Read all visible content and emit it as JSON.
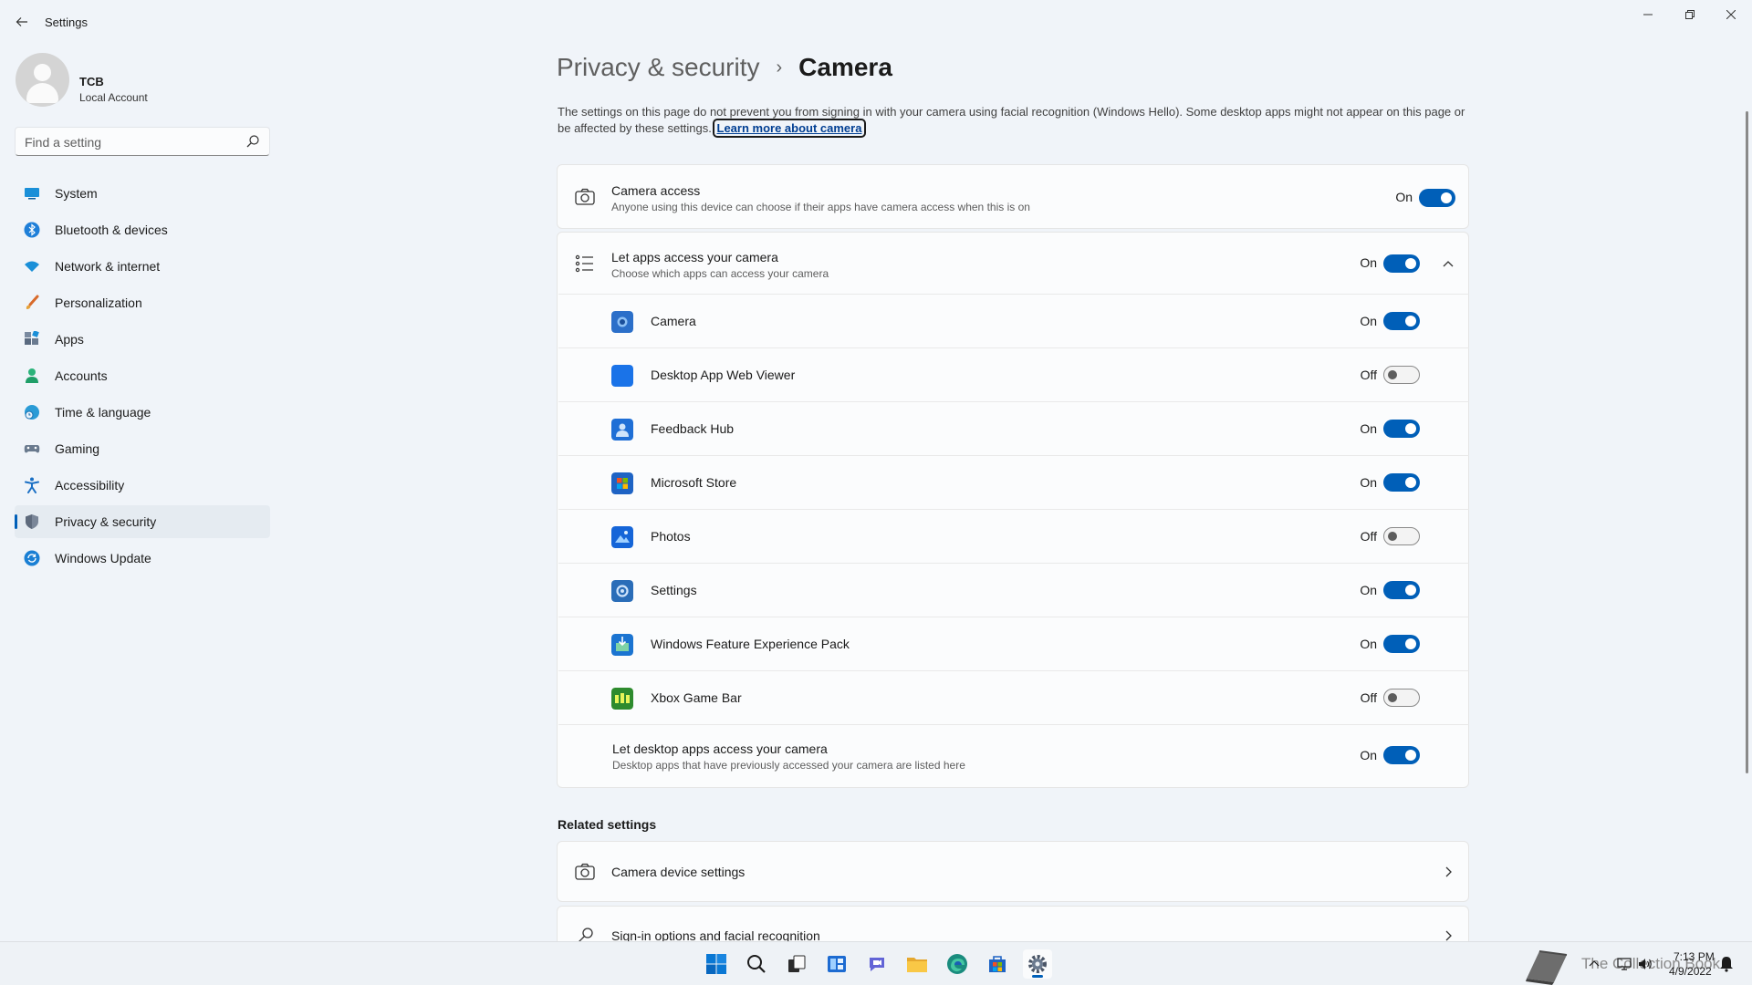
{
  "window": {
    "title": "Settings",
    "minimize": "—",
    "maximize": "❐",
    "close": "✕"
  },
  "profile": {
    "name": "TCB",
    "account_type": "Local Account"
  },
  "search": {
    "placeholder": "Find a setting"
  },
  "sidebar": {
    "items": [
      {
        "label": "System",
        "icon": "monitor-icon",
        "active": false
      },
      {
        "label": "Bluetooth & devices",
        "icon": "bluetooth-icon",
        "active": false
      },
      {
        "label": "Network & internet",
        "icon": "wifi-icon",
        "active": false
      },
      {
        "label": "Personalization",
        "icon": "brush-icon",
        "active": false
      },
      {
        "label": "Apps",
        "icon": "apps-icon",
        "active": false
      },
      {
        "label": "Accounts",
        "icon": "person-icon",
        "active": false
      },
      {
        "label": "Time & language",
        "icon": "globe-clock-icon",
        "active": false
      },
      {
        "label": "Gaming",
        "icon": "controller-icon",
        "active": false
      },
      {
        "label": "Accessibility",
        "icon": "accessibility-icon",
        "active": false
      },
      {
        "label": "Privacy & security",
        "icon": "shield-icon",
        "active": true
      },
      {
        "label": "Windows Update",
        "icon": "update-icon",
        "active": false
      }
    ]
  },
  "breadcrumb": {
    "parent": "Privacy & security",
    "separator": "›",
    "current": "Camera"
  },
  "description": {
    "text": "The settings on this page do not prevent you from signing in with your camera using facial recognition (Windows Hello). Some desktop apps might not appear on this page or be affected by these settings.",
    "link": "Learn more about camera"
  },
  "camera_access": {
    "title": "Camera access",
    "subtitle": "Anyone using this device can choose if their apps have camera access when this is on",
    "state": "On"
  },
  "apps_access": {
    "title": "Let apps access your camera",
    "subtitle": "Choose which apps can access your camera",
    "state": "On",
    "apps": [
      {
        "name": "Camera",
        "state": "On",
        "color": "#2b6fc9"
      },
      {
        "name": "Desktop App Web Viewer",
        "state": "Off",
        "color": "#1a73e8"
      },
      {
        "name": "Feedback Hub",
        "state": "On",
        "color": "#1f6fd6"
      },
      {
        "name": "Microsoft Store",
        "state": "On",
        "color": "#1e63c4"
      },
      {
        "name": "Photos",
        "state": "Off",
        "color": "#1565d8"
      },
      {
        "name": "Settings",
        "state": "On",
        "color": "#2a6db8"
      },
      {
        "name": "Windows Feature Experience Pack",
        "state": "On",
        "color": "#1b74d1"
      },
      {
        "name": "Xbox Game Bar",
        "state": "Off",
        "color": "#2e8b2e"
      }
    ]
  },
  "desktop_apps": {
    "title": "Let desktop apps access your camera",
    "subtitle": "Desktop apps that have previously accessed your camera are listed here",
    "state": "On"
  },
  "related": {
    "heading": "Related settings",
    "items": [
      {
        "label": "Camera device settings"
      },
      {
        "label": "Sign-in options and facial recognition"
      }
    ]
  },
  "tray": {
    "time": "7:13 PM",
    "date": "4/9/2022",
    "watermark": "The Collection Book"
  },
  "colors": {
    "accent": "#005fb8",
    "background": "#f0f4f9",
    "card": "#fbfcfd"
  }
}
